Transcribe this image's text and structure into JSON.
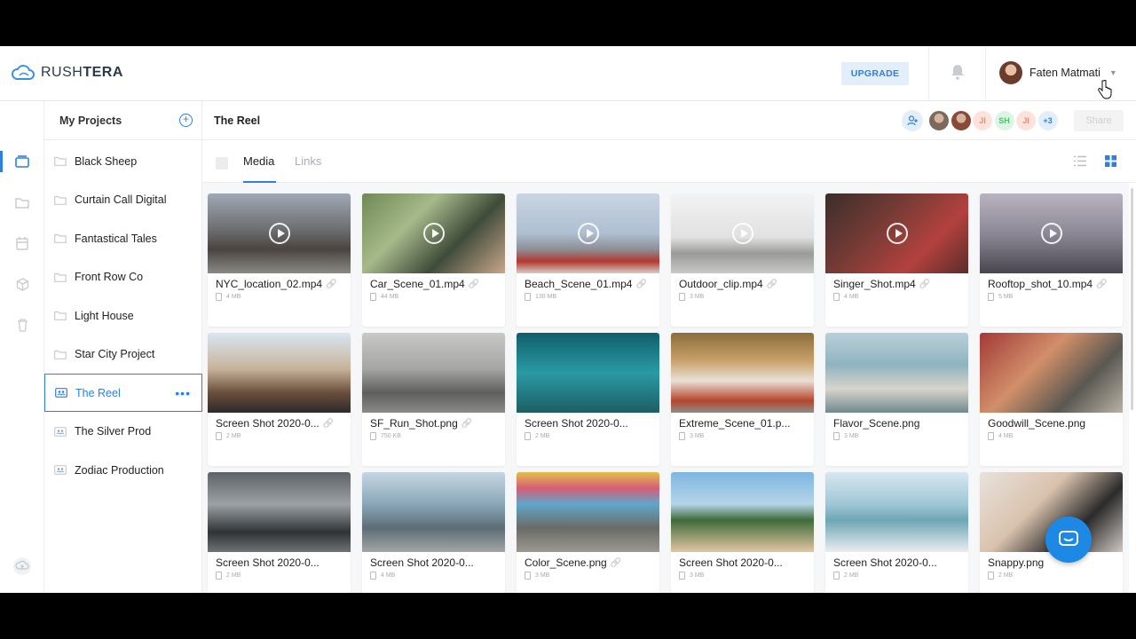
{
  "app": {
    "logo_text_light": "RUSH",
    "logo_text_bold": "TERA"
  },
  "header": {
    "upgrade_label": "UPGRADE",
    "user_name": "Faten Matmati"
  },
  "rail": {
    "icons": [
      "projects-icon",
      "folder-icon",
      "calendar-icon",
      "cube-icon",
      "trash-icon",
      "cloud-upload-icon"
    ]
  },
  "projects": {
    "title": "My Projects",
    "items": [
      {
        "label": "Black Sheep",
        "icon": "folder-icon"
      },
      {
        "label": "Curtain Call Digital",
        "icon": "folder-icon"
      },
      {
        "label": "Fantastical Tales",
        "icon": "folder-icon"
      },
      {
        "label": "Front Row Co",
        "icon": "folder-icon"
      },
      {
        "label": "Light House",
        "icon": "folder-icon"
      },
      {
        "label": "Star City Project",
        "icon": "folder-icon"
      },
      {
        "label": "The Reel",
        "icon": "shared-folder-icon",
        "active": true
      },
      {
        "label": "The Silver Prod",
        "icon": "shared-folder-icon"
      },
      {
        "label": "Zodiac Production",
        "icon": "shared-folder-icon"
      }
    ]
  },
  "main": {
    "title": "The Reel",
    "members": [
      {
        "initials": "",
        "color": "#7a6a5e"
      },
      {
        "initials": "",
        "color": "#8a4a3a"
      },
      {
        "initials": "JI",
        "color": "#fde3dc",
        "text_color": "#f08a6c"
      },
      {
        "initials": "SH",
        "color": "#dff5e4",
        "text_color": "#4cbf6a"
      },
      {
        "initials": "JI",
        "color": "#fde3dc",
        "text_color": "#f08a6c"
      },
      {
        "initials": "+3",
        "color": "#e3eefb",
        "text_color": "#2f7fe0"
      }
    ],
    "share_label": "Share",
    "tabs": [
      {
        "label": "Media"
      },
      {
        "label": "Links"
      }
    ]
  },
  "media": [
    {
      "name": "NYC_location_02.mp4",
      "size": "4 MB",
      "video": true,
      "link": true,
      "bg": "linear-gradient(180deg,#9fa9b5 0%,#6d6e70 45%,#4a4440 70%,#8c8a86 100%)"
    },
    {
      "name": "Car_Scene_01.mp4",
      "size": "44 MB",
      "video": true,
      "link": true,
      "bg": "linear-gradient(135deg,#6f8a55 0%,#a6b98a 35%,#3f4b3a 65%,#c9a68a 100%)"
    },
    {
      "name": "Beach_Scene_01.mp4",
      "size": "130 MB",
      "video": true,
      "link": true,
      "bg": "linear-gradient(180deg,#c9d5e2 0%,#aebfd2 50%,#8c8f95 70%,#b3372f 85%,#d4cfc8 100%)"
    },
    {
      "name": "Outdoor_clip.mp4",
      "size": "3 MB",
      "video": true,
      "link": true,
      "bg": "linear-gradient(180deg,#f3f3f3 0%,#e1e1e1 55%,#9a9a98 75%,#c9c9c7 100%)"
    },
    {
      "name": "Singer_Shot.mp4",
      "size": "4 MB",
      "video": true,
      "link": true,
      "bg": "linear-gradient(135deg,#3a2e2c 0%,#7a3b35 40%,#b3413e 70%,#5a2d2a 100%)"
    },
    {
      "name": "Rooftop_shot_10.mp4",
      "size": "5 MB",
      "video": true,
      "link": true,
      "bg": "linear-gradient(180deg,#b8b3bf 0%,#8c8895 50%,#4a4650 100%)"
    },
    {
      "name": "Screen Shot 2020-0...",
      "size": "2 MB",
      "video": false,
      "link": true,
      "bg": "linear-gradient(180deg,#d9e6f2 0%,#c7b39a 45%,#6a4f3c 75%,#2d2a2a 100%)"
    },
    {
      "name": "SF_Run_Shot.png",
      "size": "750 KB",
      "video": false,
      "link": true,
      "bg": "linear-gradient(180deg,#c8c8c6 0%,#a5a6a4 45%,#5e5e5c 75%,#8a8a88 100%)"
    },
    {
      "name": "Screen Shot 2020-0...",
      "size": "2 MB",
      "video": false,
      "link": false,
      "bg": "linear-gradient(180deg,#0f5f6a 0%,#2a9aa5 50%,#1d5e63 100%)"
    },
    {
      "name": "Extreme_Scene_01.p...",
      "size": "3 MB",
      "video": false,
      "link": false,
      "bg": "linear-gradient(180deg,#8a6d3b 0%,#c9a16a 35%,#e8e1d6 60%,#b6452c 85%,#8e8d89 100%)"
    },
    {
      "name": "Flavor_Scene.png",
      "size": "3 MB",
      "video": false,
      "link": false,
      "bg": "linear-gradient(180deg,#b9cfd7 0%,#8fb3c0 40%,#d8d4cb 70%,#6f8a8f 100%)"
    },
    {
      "name": "Goodwill_Scene.png",
      "size": "4 MB",
      "video": false,
      "link": false,
      "bg": "linear-gradient(135deg,#a23a37 0%,#d28f6a 40%,#5a5852 70%,#b9b2a5 100%)"
    },
    {
      "name": "Screen Shot 2020-0...",
      "size": "2 MB",
      "video": false,
      "link": false,
      "bg": "linear-gradient(180deg,#5d6266 0%,#9ba1a5 40%,#2f3336 75%,#6f7376 100%)"
    },
    {
      "name": "Screen Shot 2020-0...",
      "size": "4 MB",
      "video": false,
      "link": false,
      "bg": "linear-gradient(180deg,#c5d6e2 0%,#8aa7b8 40%,#5c6d75 70%,#a3a5a6 100%)"
    },
    {
      "name": "Color_Scene.png",
      "size": "3 MB",
      "video": false,
      "link": true,
      "bg": "linear-gradient(180deg,#e2c14a 0%,#d65d78 20%,#5fa6c9 40%,#6b6b66 70%,#9a9890 100%)"
    },
    {
      "name": "Screen Shot 2020-0...",
      "size": "3 MB",
      "video": false,
      "link": false,
      "bg": "linear-gradient(180deg,#7eb6e1 0%,#b5d5e8 40%,#3f6b3a 60%,#e2c6a3 100%)"
    },
    {
      "name": "Screen Shot 2020-0...",
      "size": "2 MB",
      "video": false,
      "link": false,
      "bg": "linear-gradient(180deg,#d8e8f0 0%,#9fc7d6 40%,#6ea6b5 60%,#e9eef0 100%)"
    },
    {
      "name": "Snappy.png",
      "size": "2 MB",
      "video": false,
      "link": false,
      "bg": "linear-gradient(135deg,#e8e2dc 0%,#d9c2ad 40%,#2b2b2b 70%,#cfc8c1 100%)"
    }
  ],
  "colors": {
    "accent": "#2f7fe0",
    "chat": "#1e88e5"
  }
}
